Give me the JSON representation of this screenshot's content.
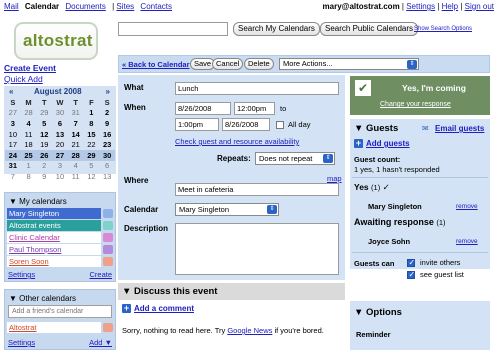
{
  "nav": {
    "items": [
      "Mail",
      "Calendar",
      "Documents",
      "Sites",
      "Contacts"
    ],
    "active": "Calendar",
    "user": "mary@altostrat.com",
    "settings": "Settings",
    "help": "Help",
    "signout": "Sign out"
  },
  "logo": "altostrat",
  "search": {
    "value": "",
    "btn_my": "Search My Calendars",
    "btn_public": "Search Public Calendars",
    "show_options": "Show Search Options"
  },
  "sidebar": {
    "create_event": "Create Event",
    "quick_add": "Quick Add",
    "minical": {
      "prev": "«",
      "month": "August 2008",
      "next": "»",
      "dow": [
        "S",
        "M",
        "T",
        "W",
        "T",
        "F",
        "S"
      ],
      "weeks": [
        [
          "27",
          "28",
          "29",
          "30",
          "31",
          "1",
          "2"
        ],
        [
          "3",
          "4",
          "5",
          "6",
          "7",
          "8",
          "9"
        ],
        [
          "10",
          "11",
          "12",
          "13",
          "14",
          "15",
          "16"
        ],
        [
          "17",
          "18",
          "19",
          "20",
          "21",
          "22",
          "23"
        ],
        [
          "24",
          "25",
          "26",
          "27",
          "28",
          "29",
          "30"
        ],
        [
          "31",
          "1",
          "2",
          "3",
          "4",
          "5",
          "6"
        ],
        [
          "7",
          "8",
          "9",
          "10",
          "11",
          "12",
          "13"
        ]
      ]
    },
    "my_calendars": {
      "title": "My calendars",
      "items": [
        {
          "name": "Mary Singleton",
          "bg": "#3f6bd1",
          "fg": "#ffffff",
          "swatch": "#8fb1e8"
        },
        {
          "name": "Altostrat events",
          "bg": "#2aa09b",
          "fg": "#ffffff",
          "swatch": "#7fd1cd"
        },
        {
          "name": "Clinic Calendar",
          "bg": "",
          "fg": "#b23aa8",
          "swatch": "#d98ad4"
        },
        {
          "name": "Paul Thompson",
          "bg": "",
          "fg": "#7a3bb0",
          "swatch": "#b48ad9"
        },
        {
          "name": "Soren Soon",
          "bg": "",
          "fg": "#d14a2a",
          "swatch": "#f0a08a"
        }
      ],
      "settings": "Settings",
      "create": "Create"
    },
    "other_calendars": {
      "title": "Other calendars",
      "add_placeholder": "Add a friend's calendar",
      "items": [
        {
          "name": "Altostrat",
          "fg": "#d14a2a",
          "swatch": "#f0a08a"
        }
      ],
      "settings": "Settings",
      "add": "Add"
    }
  },
  "toolbar": {
    "back": "« Back to Calendar",
    "save": "Save",
    "cancel": "Cancel",
    "delete": "Delete",
    "more_actions": "More Actions..."
  },
  "form": {
    "what_label": "What",
    "what_value": "Lunch",
    "when_label": "When",
    "start_date": "8/26/2008",
    "start_time": "12:00pm",
    "to": "to",
    "end_time": "1:00pm",
    "end_date": "8/26/2008",
    "all_day": "All day",
    "check_guest": "Check guest and resource availability",
    "repeats_label": "Repeats:",
    "repeats_value": "Does not repeat",
    "where_label": "Where",
    "map": "map",
    "where_value": "Meet in cafeteria",
    "calendar_label": "Calendar",
    "calendar_value": "Mary Singleton",
    "description_label": "Description",
    "description_value": ""
  },
  "discuss": {
    "title": "Discuss this event",
    "add_comment": "Add a comment",
    "message_prefix": "Sorry, nothing to read here. Try ",
    "message_link": "Google News",
    "message_suffix": " if you're bored."
  },
  "rsvp": {
    "status": "Yes, I'm coming",
    "change": "Change your response"
  },
  "guests": {
    "title": "Guests",
    "email_guests": "Email guests",
    "add_guests": "Add guests",
    "count_label": "Guest count:",
    "count_value": "1 yes, 1 hasn't responded",
    "yes_label": "Yes",
    "yes_count": "(1)",
    "yes_name": "Mary Singleton",
    "awaiting_label": "Awaiting response",
    "awaiting_count": "(1)",
    "awaiting_name": "Joyce Sohn",
    "remove": "remove",
    "can_label": "Guests can",
    "invite_others": "invite others",
    "see_list": "see guest list"
  },
  "options": {
    "title": "Options",
    "reminder": "Reminder"
  }
}
